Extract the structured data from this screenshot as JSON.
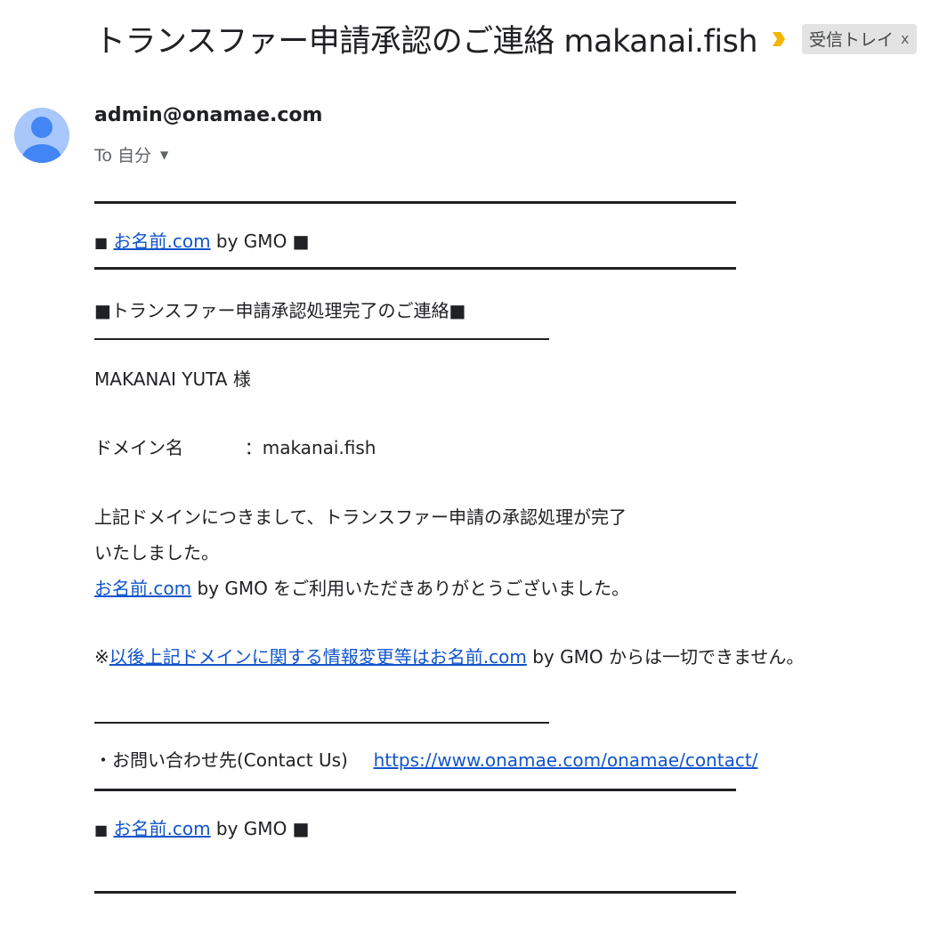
{
  "header": {
    "subject": "トランスファー申請承認のご連絡 makanai.fish",
    "label_chip": "受信トレイ",
    "label_close": "x",
    "importance_color": "#f4b400"
  },
  "message": {
    "sender": "admin@onamae.com",
    "recipient": "To 自分",
    "avatar_color": "#a8c7fa",
    "avatar_figure_color": "#4285f4"
  },
  "body": {
    "brand_prefix": "■",
    "brand_link": "お名前.com",
    "brand_suffix": "by GMO ■",
    "notice_title": "■トランスファー申請承認処理完了のご連絡■",
    "addressee": "MAKANAI YUTA 様",
    "domain_label": "ドメイン名",
    "domain_value": "：makanai.fish",
    "paragraph_line1": "上記ドメインにつきまして、トランスファー申請の承認処理が完了",
    "paragraph_line2": "いたしました。",
    "thanks_link": "お名前.com",
    "thanks_text": "by GMO をご利用いただきありがとうございました。",
    "note_prefix": "※",
    "note_link": "以後上記ドメインに関する情報変更等はお名前.com",
    "note_text": "by GMO からは一切できません。",
    "contact_label": "・お問い合わせ先(Contact Us)",
    "contact_url": "https://www.onamae.com/onamae/contact/",
    "footer_prefix": "■",
    "footer_link": "お名前.com",
    "footer_suffix": "by GMO ■"
  }
}
